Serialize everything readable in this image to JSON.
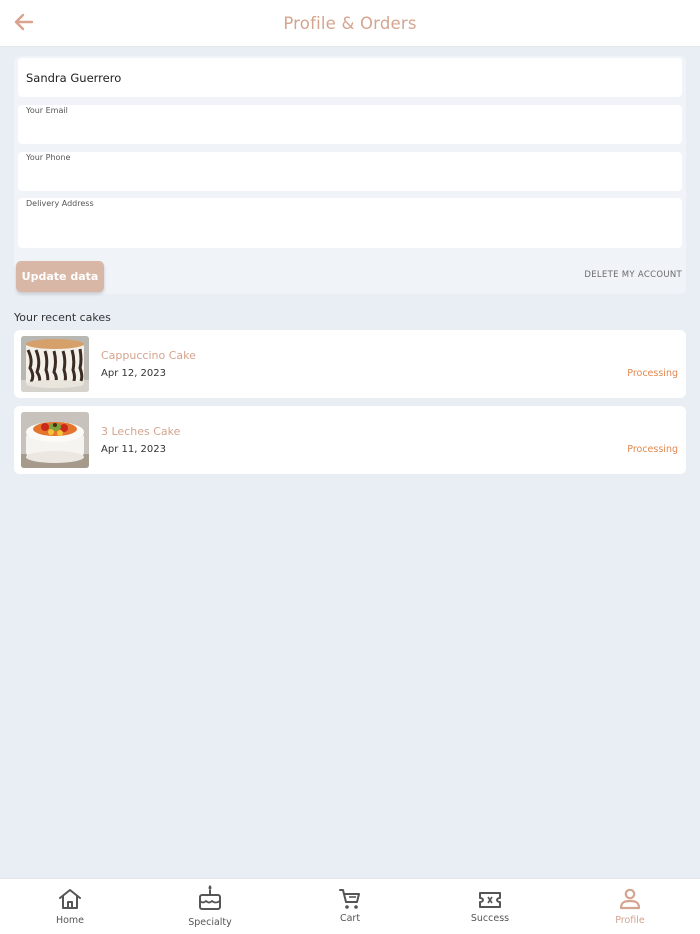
{
  "header": {
    "title": "Profile & Orders",
    "back_icon": "arrow-left-icon",
    "accent": "#d4a48f"
  },
  "profile": {
    "name_value": "Sandra Guerrero",
    "email_label": "Your Email",
    "email_value": "",
    "phone_label": "Your Phone",
    "phone_value": "",
    "address_label": "Delivery Address",
    "address_value": "",
    "update_label": "Update data",
    "delete_label": "DELETE MY ACCOUNT"
  },
  "orders": {
    "section_title": "Your recent cakes",
    "items": [
      {
        "name": "Cappuccino Cake",
        "date": "Apr 12, 2023",
        "status": "Processing",
        "image": "cappuccino-cake-photo"
      },
      {
        "name": "3 Leches Cake",
        "date": "Apr 11, 2023",
        "status": "Processing",
        "image": "tres-leches-cake-photo"
      }
    ],
    "status_color": "#e2884f"
  },
  "nav": {
    "items": [
      {
        "label": "Home",
        "icon": "home-icon"
      },
      {
        "label": "Specialty",
        "icon": "cake-icon"
      },
      {
        "label": "Cart",
        "icon": "cart-icon"
      },
      {
        "label": "Success",
        "icon": "ticket-icon"
      },
      {
        "label": "Profile",
        "icon": "person-icon",
        "active": true
      }
    ]
  }
}
